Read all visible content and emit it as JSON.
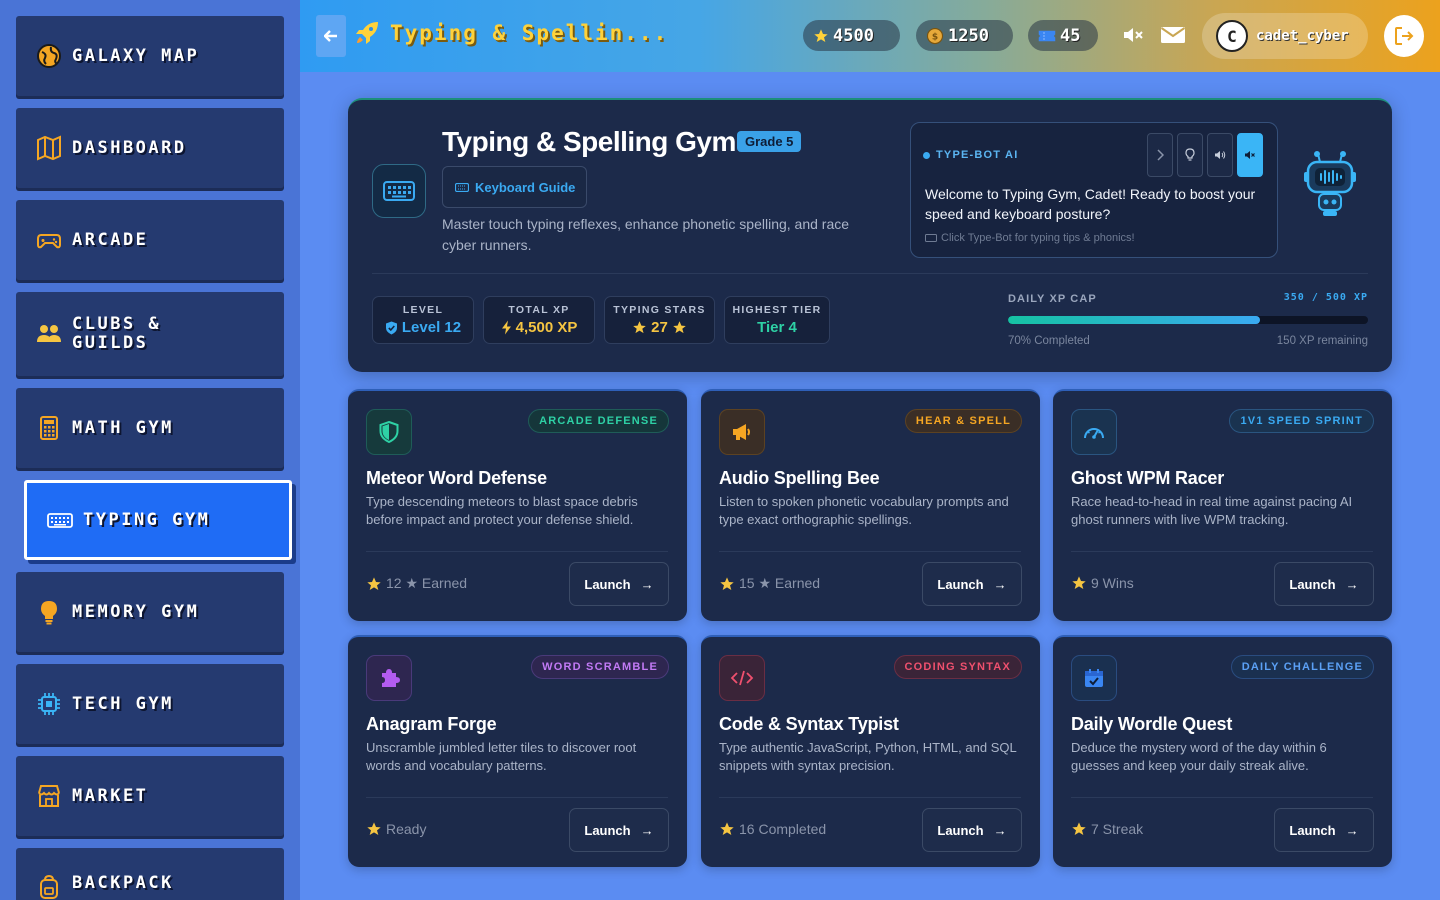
{
  "sidebar": {
    "items": [
      {
        "label": "GALAXY MAP"
      },
      {
        "label": "DASHBOARD"
      },
      {
        "label": "ARCADE"
      },
      {
        "label": "CLUBS &\nGUILDS"
      },
      {
        "label": "MATH GYM"
      },
      {
        "label": "TYPING GYM"
      },
      {
        "label": "MEMORY GYM"
      },
      {
        "label": "TECH GYM"
      },
      {
        "label": "MARKET"
      },
      {
        "label": "BACKPACK"
      }
    ]
  },
  "topbar": {
    "title": "Typing & Spellin...",
    "stars": "4500",
    "coins": "1250",
    "tickets": "45",
    "username": "cadet_cyber",
    "avatar_letter": "C"
  },
  "hero": {
    "title": "Typing & Spelling Gym",
    "grade": "Grade 5",
    "keyboard_guide": "Keyboard Guide",
    "description": "Master touch typing reflexes, enhance phonetic spelling, and race cyber runners.",
    "bot": {
      "label": "TYPE-BOT AI",
      "message": "Welcome to Typing Gym, Cadet! Ready to boost your speed and keyboard posture?",
      "hint": "Click Type-Bot for typing tips & phonics!"
    },
    "stats": [
      {
        "label": "LEVEL",
        "value": "Level 12",
        "color": "#3aaaf2"
      },
      {
        "label": "TOTAL XP",
        "value": "4,500 XP",
        "color": "#f5c542"
      },
      {
        "label": "TYPING STARS",
        "value": "27",
        "color": "#f5c542"
      },
      {
        "label": "HIGHEST TIER",
        "value": "Tier 4",
        "color": "#2ed1a5"
      }
    ],
    "xp": {
      "label": "DAILY XP CAP",
      "value": "350 / 500 XP",
      "percent": 70,
      "completed": "70% Completed",
      "remaining": "150 XP remaining"
    }
  },
  "cards": [
    {
      "title": "Meteor Word Defense",
      "badge": "ARCADE DEFENSE",
      "desc": "Type descending meteors to blast space debris before impact and protect your defense shield.",
      "stat": "12 ★ Earned",
      "launch": "Launch",
      "accent": "#2ed1a5",
      "icon": "shield-icon"
    },
    {
      "title": "Audio Spelling Bee",
      "badge": "HEAR & SPELL",
      "desc": "Listen to spoken phonetic vocabulary prompts and type exact orthographic spellings.",
      "stat": "15 ★ Earned",
      "launch": "Launch",
      "accent": "#f5a623",
      "icon": "megaphone-icon"
    },
    {
      "title": "Ghost WPM Racer",
      "badge": "1V1 SPEED SPRINT",
      "desc": "Race head-to-head in real time against pacing AI ghost runners with live WPM tracking.",
      "stat": "9 Wins",
      "launch": "Launch",
      "accent": "#3aaaf2",
      "icon": "speedometer-icon"
    },
    {
      "title": "Anagram Forge",
      "badge": "WORD SCRAMBLE",
      "desc": "Unscramble jumbled letter tiles to discover root words and vocabulary patterns.",
      "stat": "Ready",
      "launch": "Launch",
      "accent": "#b35cf0",
      "icon": "puzzle-icon"
    },
    {
      "title": "Code & Syntax Typist",
      "badge": "CODING SYNTAX",
      "desc": "Type authentic JavaScript, Python, HTML, and SQL snippets with syntax precision.",
      "stat": "16 Completed",
      "launch": "Launch",
      "accent": "#f0506e",
      "icon": "code-icon"
    },
    {
      "title": "Daily Wordle Quest",
      "badge": "DAILY CHALLENGE",
      "desc": "Deduce the mystery word of the day within 6 guesses and keep your daily streak alive.",
      "stat": "7 Streak",
      "launch": "Launch",
      "accent": "#3a86f2",
      "icon": "calendar-icon"
    }
  ]
}
